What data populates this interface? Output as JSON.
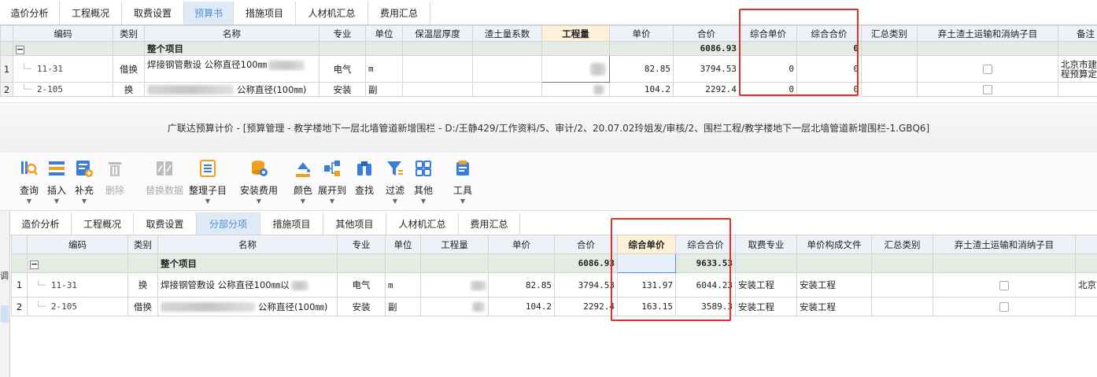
{
  "top_tabs": [
    {
      "label": "造价分析",
      "active": false
    },
    {
      "label": "工程概况",
      "active": false
    },
    {
      "label": "取费设置",
      "active": false
    },
    {
      "label": "预算书",
      "active": true
    },
    {
      "label": "措施项目",
      "active": false
    },
    {
      "label": "人材机汇总",
      "active": false
    },
    {
      "label": "费用汇总",
      "active": false
    }
  ],
  "top_grid": {
    "headers": [
      "编码",
      "类别",
      "名称",
      "专业",
      "单位",
      "保温层厚度",
      "渣土量系数",
      "工程量",
      "单价",
      "合价",
      "综合单价",
      "综合合价",
      "汇总类别",
      "弃土渣土运输和消纳子目",
      "备注"
    ],
    "total_row": {
      "collapse": "−",
      "name": "整个项目",
      "total_price": "6086.93",
      "combined_total": "0"
    },
    "rows": [
      {
        "index": "1",
        "code": "11-31",
        "type": "借换",
        "name": "焊接钢管敷设 公称直径100㎜",
        "major": "电气",
        "unit": "m",
        "unit_price": "82.85",
        "total_price": "3794.53",
        "combined_unit_price": "0",
        "combined_total": "0",
        "remark": "北京市建设工程预算定额"
      },
      {
        "index": "2",
        "code": "2-105",
        "type": "换",
        "name": "公称直径(100㎜)",
        "major": "安装",
        "unit": "副",
        "unit_price": "104.2",
        "total_price": "2292.4",
        "combined_unit_price": "0",
        "combined_total": "0",
        "remark": ""
      }
    ],
    "remark_line1": "北京市建设",
    "remark_line2": "程预算定额"
  },
  "title_bar": {
    "text": "广联达预算计价 - [预算管理 - 教学楼地下一层北墙管道新增围栏 - D:/王静429/工作资料/5、审计/2、20.07.02玲姐发/审核/2、围栏工程/教学楼地下一层北墙管道新增围栏-1.GBQ6]"
  },
  "toolbar": [
    {
      "label": "查询",
      "icon": "query-icon",
      "disabled": false,
      "dropdown": true
    },
    {
      "label": "插入",
      "icon": "insert-icon",
      "disabled": false,
      "dropdown": true
    },
    {
      "label": "补充",
      "icon": "supplement-icon",
      "disabled": false,
      "dropdown": true
    },
    {
      "label": "删除",
      "icon": "delete-icon",
      "disabled": true,
      "dropdown": false
    },
    {
      "label": "替换数据",
      "icon": "replace-data-icon",
      "disabled": true,
      "dropdown": false
    },
    {
      "label": "整理子目",
      "icon": "organize-icon",
      "disabled": false,
      "dropdown": true
    },
    {
      "label": "安装费用",
      "icon": "install-fee-icon",
      "disabled": false,
      "dropdown": true
    },
    {
      "label": "颜色",
      "icon": "color-icon",
      "disabled": false,
      "dropdown": true
    },
    {
      "label": "展开到",
      "icon": "expand-icon",
      "disabled": false,
      "dropdown": true
    },
    {
      "label": "查找",
      "icon": "find-icon",
      "disabled": false,
      "dropdown": false
    },
    {
      "label": "过滤",
      "icon": "filter-icon",
      "disabled": false,
      "dropdown": true
    },
    {
      "label": "其他",
      "icon": "other-icon",
      "disabled": false,
      "dropdown": true
    },
    {
      "label": "工具",
      "icon": "tool-icon",
      "disabled": false,
      "dropdown": true
    }
  ],
  "bottom_tabs": [
    {
      "label": "造价分析",
      "active": false
    },
    {
      "label": "工程概况",
      "active": false
    },
    {
      "label": "取费设置",
      "active": false
    },
    {
      "label": "分部分项",
      "active": true
    },
    {
      "label": "措施项目",
      "active": false
    },
    {
      "label": "其他项目",
      "active": false
    },
    {
      "label": "人材机汇总",
      "active": false
    },
    {
      "label": "费用汇总",
      "active": false
    }
  ],
  "bottom_grid": {
    "headers": [
      "编码",
      "类别",
      "名称",
      "专业",
      "单位",
      "工程量",
      "单价",
      "合价",
      "综合单价",
      "综合合价",
      "取费专业",
      "单价构成文件",
      "汇总类别",
      "弃土渣土运输和消纳子目"
    ],
    "total_row": {
      "collapse": "−",
      "name": "整个项目",
      "total_price": "6086.93",
      "combined_total": "9633.53"
    },
    "rows": [
      {
        "index": "1",
        "code": "11-31",
        "type": "换",
        "name": "焊接钢管敷设 公称直径100㎜以",
        "major": "电气",
        "unit": "m",
        "unit_price": "82.85",
        "total_price": "3794.53",
        "combined_unit_price": "131.97",
        "combined_total": "6044.23",
        "fee_major": "安装工程",
        "composition_file": "安装工程",
        "remark": "北京市"
      },
      {
        "index": "2",
        "code": "2-105",
        "type": "借换",
        "name": "公称直径(100㎜)",
        "major": "安装",
        "unit": "副",
        "unit_price": "104.2",
        "total_price": "2292.4",
        "combined_unit_price": "163.15",
        "combined_total": "3589.3",
        "fee_major": "安装工程",
        "composition_file": "安装工程",
        "remark": ""
      }
    ]
  },
  "left_strip": {
    "text": "调"
  }
}
